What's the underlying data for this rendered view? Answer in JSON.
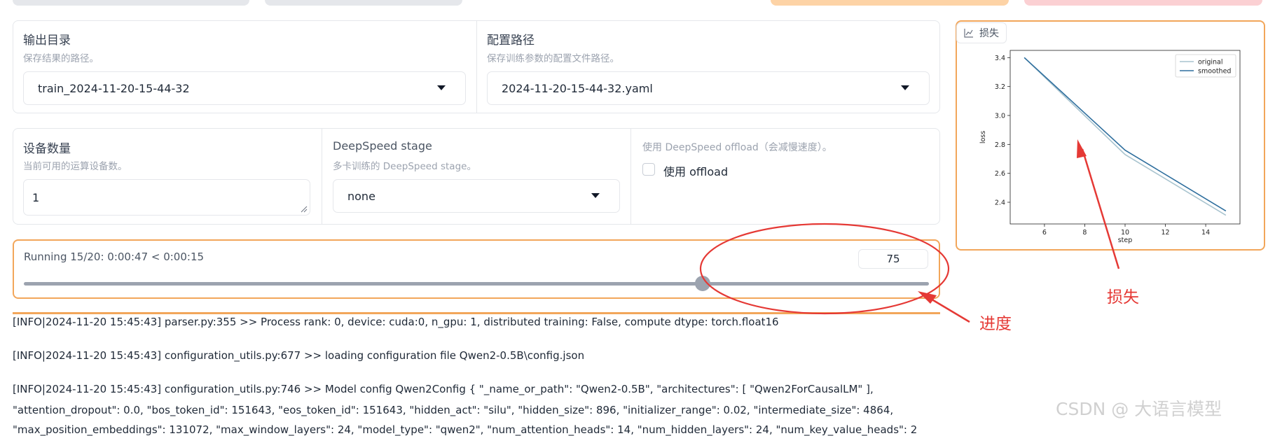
{
  "output_dir": {
    "label": "输出目录",
    "info": "保存结果的路径。",
    "value": "train_2024-11-20-15-44-32"
  },
  "config_path": {
    "label": "配置路径",
    "info": "保存训练参数的配置文件路径。",
    "value": "2024-11-20-15-44-32.yaml"
  },
  "device_count": {
    "label": "设备数量",
    "info": "当前可用的运算设备数。",
    "value": "1"
  },
  "deepspeed_stage": {
    "label": "DeepSpeed stage",
    "info": "多卡训练的 DeepSpeed stage。",
    "value": "none"
  },
  "deepspeed_offload": {
    "info": "使用 DeepSpeed offload（会减慢速度）。",
    "checkbox_label": "使用 offload",
    "checked": false
  },
  "progress": {
    "status": "Running 15/20: 0:00:47 < 0:00:15",
    "value_display": "75",
    "fraction": 0.75
  },
  "loss_panel": {
    "tab_label": "损失"
  },
  "chart_data": {
    "type": "line",
    "xlabel": "step",
    "ylabel": "loss",
    "xlim": [
      4.3,
      15.7
    ],
    "ylim": [
      2.25,
      3.45
    ],
    "x_ticks": [
      "6",
      "8",
      "10",
      "12",
      "14"
    ],
    "y_ticks": [
      "2.4",
      "2.6",
      "2.8",
      "3.0",
      "3.2",
      "3.4"
    ],
    "legend_position": "top-right",
    "series": [
      {
        "name": "original",
        "color": "#a9c4cf",
        "x": [
          5,
          10,
          15
        ],
        "y": [
          3.4,
          2.73,
          2.31
        ]
      },
      {
        "name": "smoothed",
        "color": "#2f6f9e",
        "x": [
          5,
          10,
          15
        ],
        "y": [
          3.4,
          2.76,
          2.34
        ]
      }
    ]
  },
  "logs": [
    "[INFO|2024-11-20 15:45:43] parser.py:355 >> Process rank: 0, device: cuda:0, n_gpu: 1, distributed training: False, compute dtype: torch.float16",
    "[INFO|2024-11-20 15:45:43] configuration_utils.py:677 >> loading configuration file Qwen2-0.5B\\config.json",
    "[INFO|2024-11-20 15:45:43] configuration_utils.py:746 >> Model config Qwen2Config { \"_name_or_path\": \"Qwen2-0.5B\", \"architectures\": [ \"Qwen2ForCausalLM\" ],",
    "\"attention_dropout\": 0.0, \"bos_token_id\": 151643, \"eos_token_id\": 151643, \"hidden_act\": \"silu\", \"hidden_size\": 896, \"initializer_range\": 0.02, \"intermediate_size\": 4864,",
    "\"max_position_embeddings\": 131072, \"max_window_layers\": 24, \"model_type\": \"qwen2\", \"num_attention_heads\": 14, \"num_hidden_layers\": 24, \"num_key_value_heads\": 2"
  ],
  "annotations": {
    "progress_label": "进度",
    "loss_label": "损失"
  },
  "watermark": "CSDN @ 大语言模型"
}
